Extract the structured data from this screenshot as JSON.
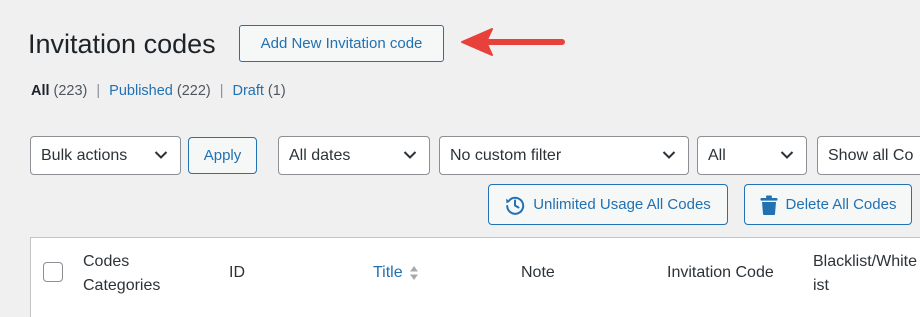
{
  "page": {
    "title": "Invitation codes",
    "add_new_label": "Add New Invitation code"
  },
  "filters": {
    "all_label": "All",
    "all_count": "(223)",
    "published_label": "Published",
    "published_count": "(222)",
    "draft_label": "Draft",
    "draft_count": "(1)",
    "separator": "|"
  },
  "toolbar": {
    "bulk_actions": "Bulk actions",
    "apply": "Apply",
    "dates": "All dates",
    "custom_filter": "No custom filter",
    "all": "All",
    "show_all": "Show all Co"
  },
  "actions": {
    "unlimited_usage": "Unlimited Usage All Codes",
    "delete_all": "Delete All Codes"
  },
  "table": {
    "columns": {
      "categories_line1": "Codes",
      "categories_line2": "Categories",
      "id": "ID",
      "title": "Title",
      "note": "Note",
      "invitation_code": "Invitation Code",
      "blacklist_line1": "Blacklist/White",
      "blacklist_line2": "ist"
    }
  },
  "colors": {
    "accent": "#2271b1",
    "arrow": "#e8403b",
    "background": "#f0f0f1"
  }
}
